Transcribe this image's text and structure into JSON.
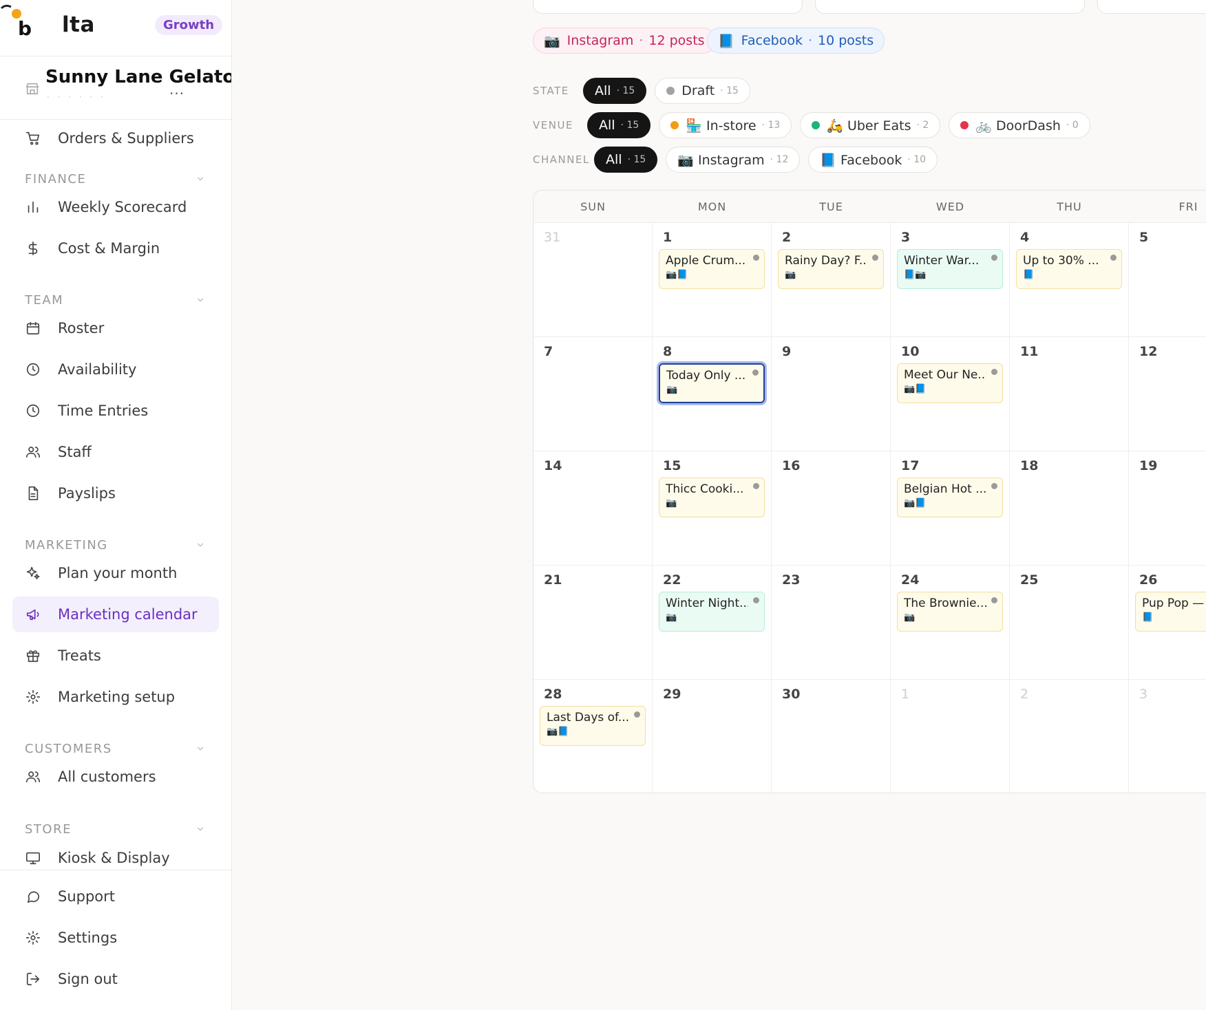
{
  "brand": {
    "name": "lta",
    "plan": "Growth"
  },
  "store": {
    "name": "Sunny Lane Gelato",
    "more": "···"
  },
  "nav": {
    "orders": "Orders & Suppliers",
    "sections": {
      "finance": "FINANCE",
      "team": "TEAM",
      "marketing": "MARKETING",
      "customers": "CUSTOMERS",
      "store": "STORE"
    },
    "items": {
      "weekly_scorecard": "Weekly Scorecard",
      "cost_margin": "Cost & Margin",
      "roster": "Roster",
      "availability": "Availability",
      "time_entries": "Time Entries",
      "staff": "Staff",
      "payslips": "Payslips",
      "plan_month": "Plan your month",
      "marketing_calendar": "Marketing calendar",
      "treats": "Treats",
      "marketing_setup": "Marketing setup",
      "all_customers": "All customers",
      "kiosk": "Kiosk & Display"
    },
    "footer": {
      "support": "Support",
      "settings": "Settings",
      "sign_out": "Sign out"
    }
  },
  "summary": {
    "instagram": {
      "icon": "📷",
      "label": "Instagram",
      "count": "12 posts"
    },
    "facebook": {
      "icon": "📘",
      "label": "Facebook",
      "count": "10 posts"
    }
  },
  "filters": {
    "state": {
      "label": "STATE",
      "chips": [
        {
          "label": "All",
          "count": "· 15"
        },
        {
          "label": "Draft",
          "count": "· 15"
        }
      ]
    },
    "venue": {
      "label": "VENUE",
      "chips": [
        {
          "label": "All",
          "count": "· 15"
        },
        {
          "label": "🏪 In-store",
          "count": "· 13"
        },
        {
          "label": "🛵 Uber Eats",
          "count": "· 2"
        },
        {
          "label": "🚲 DoorDash",
          "count": "· 0"
        }
      ]
    },
    "channel": {
      "label": "CHANNEL",
      "chips": [
        {
          "label": "All",
          "count": "· 15"
        },
        {
          "label": "📷 Instagram",
          "count": "· 12"
        },
        {
          "label": "📘 Facebook",
          "count": "· 10"
        }
      ]
    }
  },
  "colors": {
    "accent": "#6b2fc0",
    "in_store": "#f39c12",
    "uber_eats": "#1db37a",
    "doordash": "#e8334a"
  },
  "calendar": {
    "weekdays": [
      "SUN",
      "MON",
      "TUE",
      "WED",
      "THU",
      "FRI"
    ],
    "weeks": [
      [
        "31",
        "1",
        "2",
        "3",
        "4",
        "5"
      ],
      [
        "7",
        "8",
        "9",
        "10",
        "11",
        "12"
      ],
      [
        "14",
        "15",
        "16",
        "17",
        "18",
        "19"
      ],
      [
        "21",
        "22",
        "23",
        "24",
        "25",
        "26"
      ],
      [
        "28",
        "29",
        "30",
        "1",
        "2",
        "3"
      ]
    ],
    "events": {
      "w0d1": {
        "title": "Apple Crum...",
        "icons": "📷📘"
      },
      "w0d2": {
        "title": "Rainy Day? F...",
        "icons": "📷"
      },
      "w0d3": {
        "title": "Winter War...",
        "icons": "📘📷"
      },
      "w0d4": {
        "title": "Up to 30% ...",
        "icons": "📘"
      },
      "w1d1": {
        "title": "Today Only ...",
        "icons": "📷"
      },
      "w1d3": {
        "title": "Meet Our Ne...",
        "icons": "📷📘"
      },
      "w2d1": {
        "title": "Thicc Cooki...",
        "icons": "📷"
      },
      "w2d3": {
        "title": "Belgian Hot ...",
        "icons": "📷📘"
      },
      "w3d1": {
        "title": "Winter Night...",
        "icons": "📷"
      },
      "w3d3": {
        "title": "The Brownie...",
        "icons": "📷"
      },
      "w3d5": {
        "title": "Pup Pop — ...",
        "icons": "📘"
      },
      "w4d0": {
        "title": "Last Days of...",
        "icons": "📷📘"
      }
    }
  }
}
